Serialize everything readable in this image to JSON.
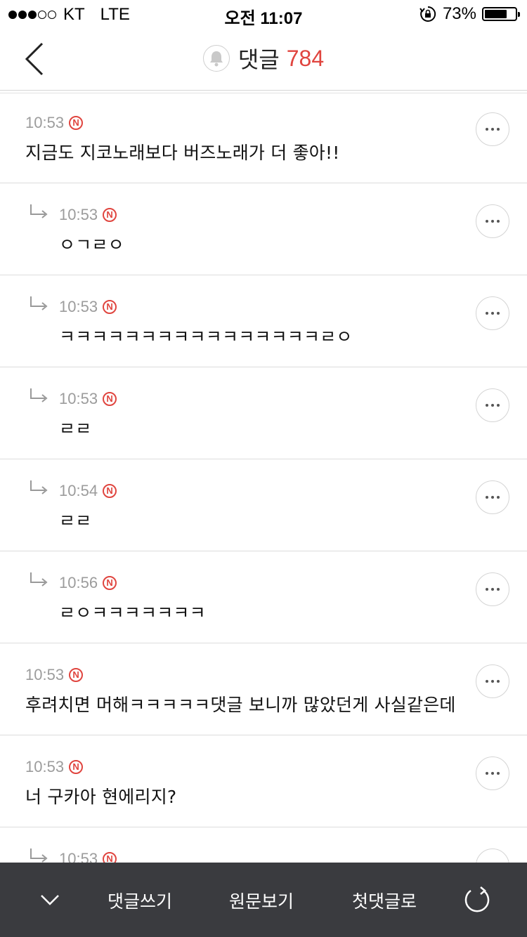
{
  "status_bar": {
    "carrier": "KT",
    "network": "LTE",
    "time": "오전 11:07",
    "battery": "73%",
    "battery_level": 0.73,
    "signal_bars": 3,
    "signal_total": 5
  },
  "nav": {
    "title": "댓글",
    "count": "784",
    "accent_color": "#e0453f"
  },
  "comments": [
    {
      "time": "10:53",
      "badge": "N",
      "text": "지금도 지코노래보다 버즈노래가 더 좋아!!",
      "reply": false
    },
    {
      "time": "10:53",
      "badge": "N",
      "text": "ㅇㄱㄹㅇ",
      "reply": true
    },
    {
      "time": "10:53",
      "badge": "N",
      "text": "ㅋㅋㅋㅋㅋㅋㅋㅋㅋㅋㅋㅋㅋㅋㅋㅋㄹㅇ",
      "reply": true
    },
    {
      "time": "10:53",
      "badge": "N",
      "text": "ㄹㄹ",
      "reply": true
    },
    {
      "time": "10:54",
      "badge": "N",
      "text": "ㄹㄹ",
      "reply": true
    },
    {
      "time": "10:56",
      "badge": "N",
      "text": "ㄹㅇㅋㅋㅋㅋㅋㅋㅋ",
      "reply": true
    },
    {
      "time": "10:53",
      "badge": "N",
      "text": "후려치면 머해ㅋㅋㅋㅋㅋ댓글 보니까 많았던게 사실같은데",
      "reply": false
    },
    {
      "time": "10:53",
      "badge": "N",
      "text": "너 구카아 현에리지?",
      "reply": false
    },
    {
      "time": "10:53",
      "badge": "N",
      "text": "",
      "reply": true
    }
  ],
  "bottom_bar": {
    "write": "댓글쓰기",
    "view_original": "원문보기",
    "first_comment": "첫댓글로"
  },
  "icons": {
    "back": "back-chevron-icon",
    "bell": "bell-icon",
    "reply": "reply-arrow-icon",
    "more": "more-icon",
    "collapse": "chevron-down-icon",
    "refresh": "refresh-icon"
  }
}
